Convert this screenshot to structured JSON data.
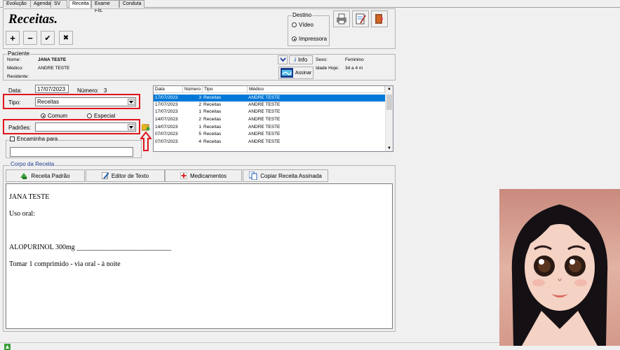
{
  "tabs": [
    "Evolução",
    "Agenda",
    "SV",
    "Receita",
    "Exame Fís.",
    "Conduta"
  ],
  "header": {
    "title": "Receitas."
  },
  "toolbar": {
    "add": "+",
    "remove": "−",
    "confirm": "✔",
    "cancel": "✖"
  },
  "destino": {
    "legend": "Destino",
    "video": "Vídeo",
    "impressora": "Impressora",
    "selected": "Impressora"
  },
  "paciente": {
    "legend": "Paciente",
    "nome_label": "Nome:",
    "nome": "JANA TESTE",
    "medico_label": "Médico:",
    "medico": "ANDRE TESTE",
    "residente_label": "Residente:",
    "info_label": "Info",
    "assinar_label": "Assinar",
    "sexo_label": "Sexo:",
    "sexo": "Feminino",
    "idade_label": "Idade Hoje:",
    "idade": "34 a 4 m"
  },
  "form": {
    "data_label": "Data:",
    "data": "17/07/2023",
    "numero_label": "Número:",
    "numero": "3",
    "tipo_label": "Tipo:",
    "tipo": "Receitas",
    "comum": "Comum",
    "especial": "Especial",
    "selected_option": "Comum",
    "padroes_label": "Padrões:",
    "padroes": "",
    "encaminha_label": "Encaminha para",
    "encaminha": ""
  },
  "grid": {
    "columns": [
      "Data",
      "Número",
      "Tipo",
      "Médico"
    ],
    "rows": [
      [
        "17/07/2023",
        "3",
        "Receitas",
        "ANDRE TESTE"
      ],
      [
        "17/07/2023",
        "2",
        "Receitas",
        "ANDRE TESTE"
      ],
      [
        "17/07/2023",
        "1",
        "Receitas",
        "ANDRE TESTE"
      ],
      [
        "14/07/2023",
        "2",
        "Receitas",
        "ANDRE TESTE"
      ],
      [
        "14/07/2023",
        "1",
        "Receitas",
        "ANDRE TESTE"
      ],
      [
        "07/07/2023",
        "5",
        "Receitas",
        "ANDRE TESTE"
      ],
      [
        "07/07/2023",
        "4",
        "Receitas",
        "ANDRE TESTE"
      ]
    ],
    "selected_row": 0
  },
  "corpo": {
    "legend": "Corpo da Receita",
    "receita_padrao": "Receita Padrão",
    "editor_texto": "Editor de Texto",
    "medicamentos": "Medicamentos",
    "copiar": "Copiar Receita Assinada",
    "lines": [
      "JANA TESTE",
      "Uso oral:",
      "ALOPURINOL 300mg ___________________________",
      "Tomar 1 comprimido - via oral - à noite"
    ]
  },
  "colors": {
    "selection": "#0078d7",
    "highlight": "#e0151e"
  }
}
